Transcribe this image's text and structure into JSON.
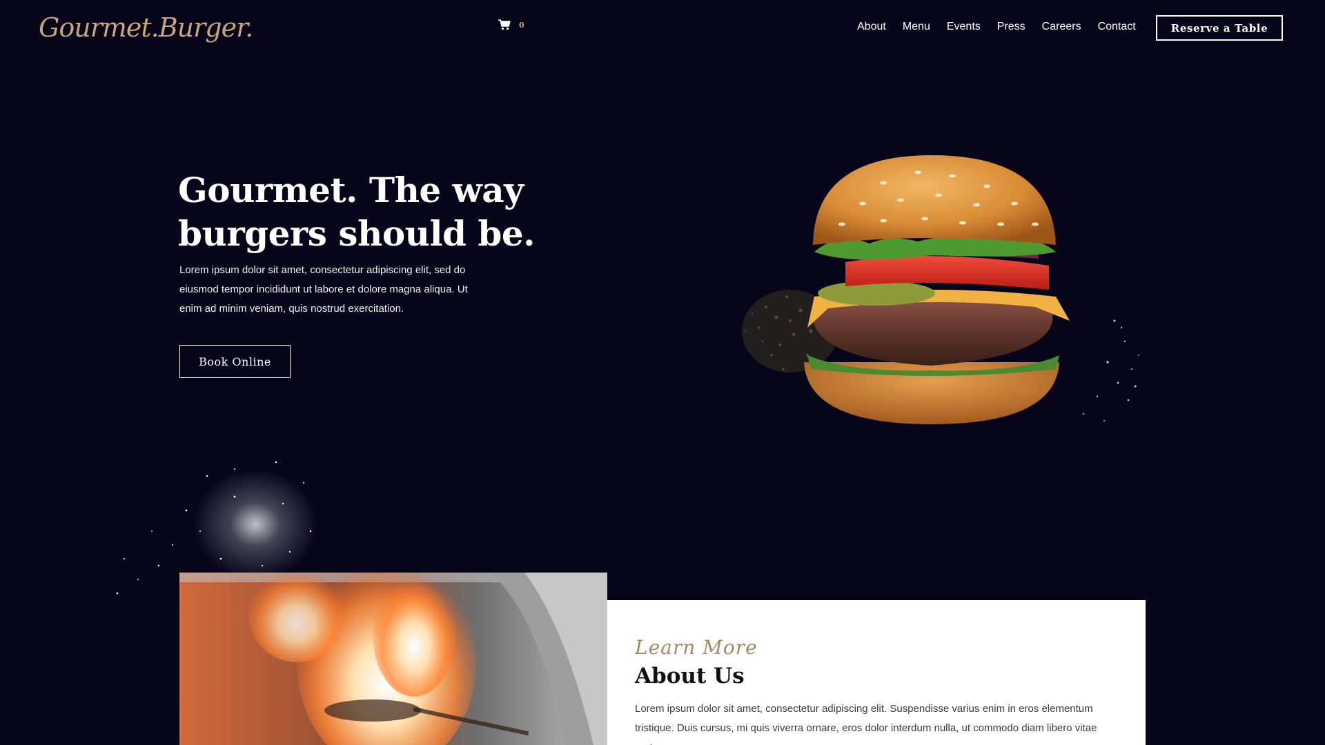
{
  "header": {
    "logo_text": "Gourmet.Burger.",
    "cart": {
      "icon": "shopping-cart-icon",
      "count": "0"
    },
    "nav": [
      {
        "label": "About"
      },
      {
        "label": "Menu"
      },
      {
        "label": "Events"
      },
      {
        "label": "Press"
      },
      {
        "label": "Careers"
      },
      {
        "label": "Contact"
      }
    ],
    "reserve_button": "Reserve a Table"
  },
  "hero": {
    "title": "Gourmet. The way burgers should be.",
    "text": "Lorem ipsum dolor sit amet, consectetur adipiscing elit, sed do eiusmod tempor incididunt ut labore et dolore magna aliqua. Ut enim ad minim veniam, quis nostrud exercitation.",
    "button": "Book Online",
    "image": "burger-image"
  },
  "about": {
    "image": "kitchen-flame-photo",
    "kicker": "Learn More",
    "title": "About Us",
    "text": "Lorem ipsum dolor sit amet, consectetur adipiscing elit. Suspendisse varius enim in eros elementum tristique. Duis cursus, mi quis viverra ornare, eros dolor interdum nulla, ut commodo diam libero vitae erat."
  },
  "colors": {
    "background": "#06051a",
    "accent_gold": "#c8a57a",
    "card_background": "#ffffff"
  }
}
